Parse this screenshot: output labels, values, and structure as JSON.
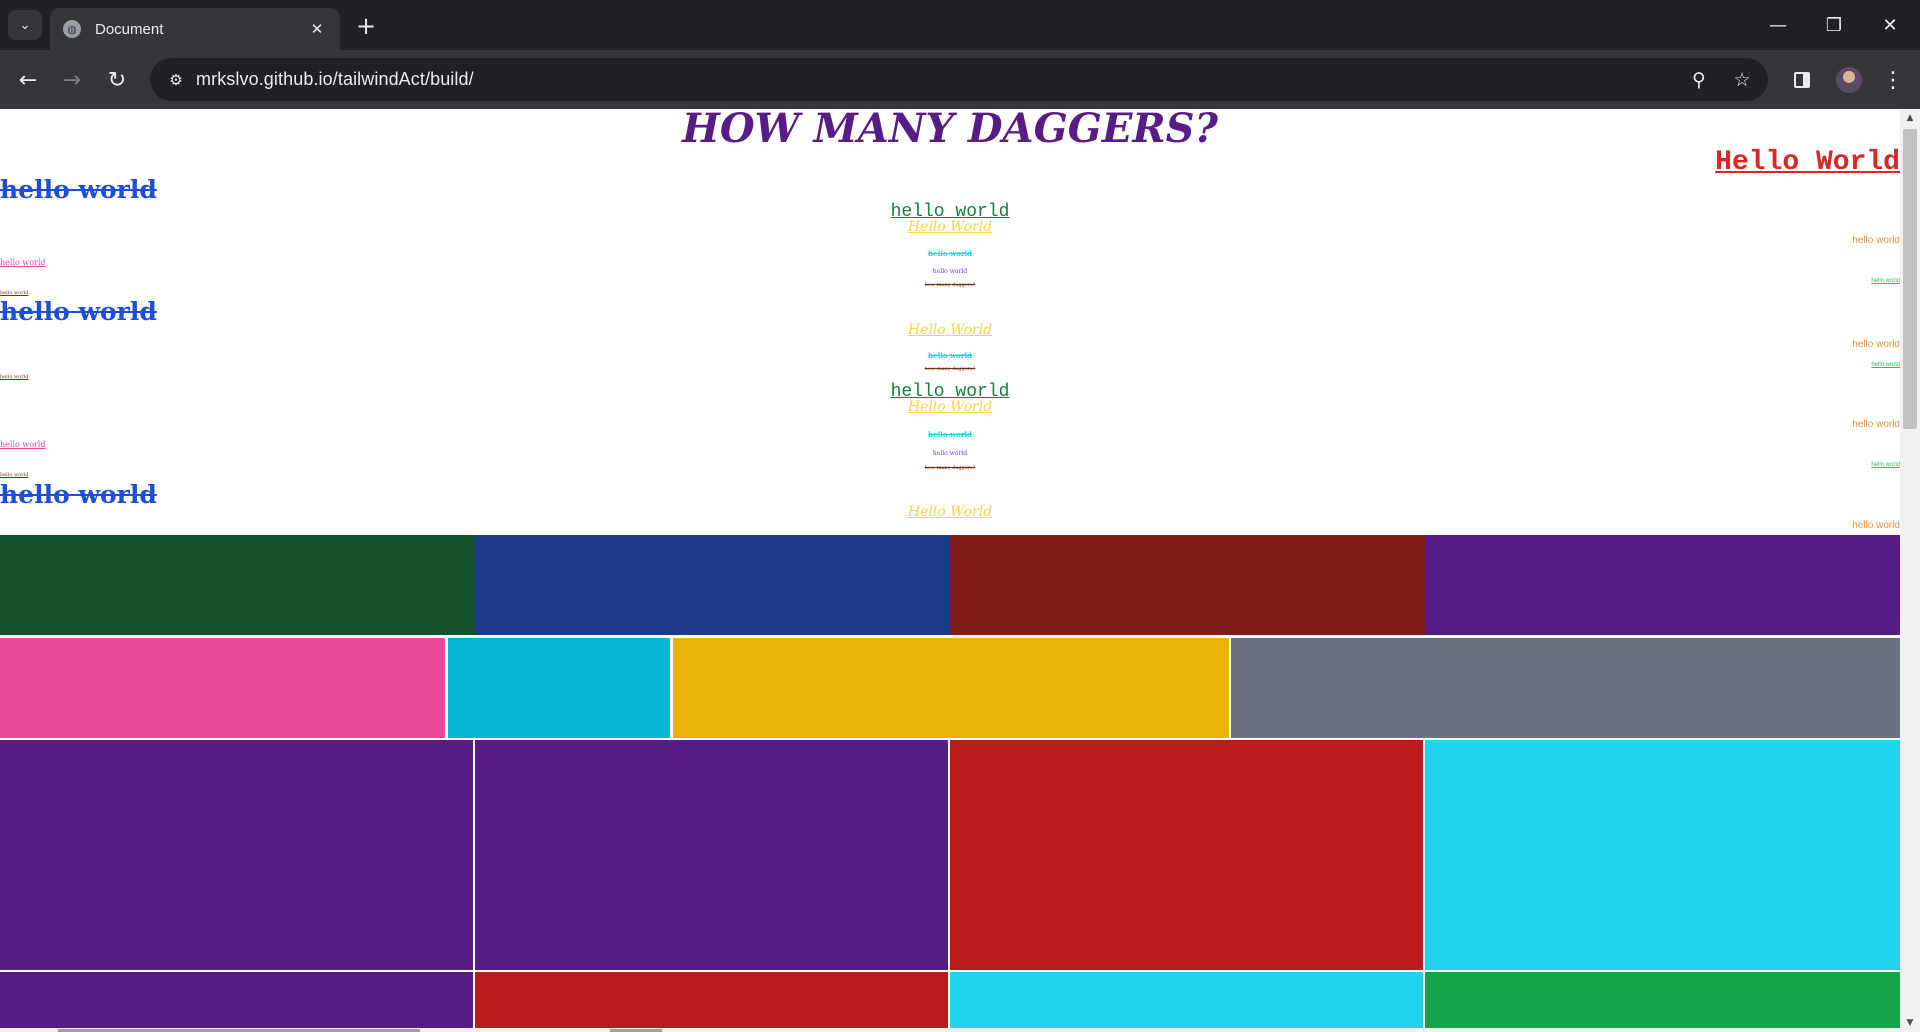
{
  "browser": {
    "tab_title": "Document",
    "url": "mrkslvo.github.io/tailwindAct/build/",
    "icons": {
      "tab_search": "chevron-down-icon",
      "favicon": "globe-icon",
      "tab_close": "close-icon",
      "new_tab": "plus-icon",
      "minimize": "minimize-icon",
      "restore": "restore-icon",
      "close": "close-icon",
      "back": "arrow-left-icon",
      "forward": "arrow-right-icon",
      "reload": "reload-icon",
      "site_info": "tune-icon",
      "zoom": "zoom-icon",
      "bookmark": "star-icon",
      "side_panel": "side-panel-icon",
      "profile": "avatar",
      "menu": "more-vert-icon"
    }
  },
  "page": {
    "heading": "HOW MANY DAGGERS?",
    "texts": {
      "hello_world_lower": "hello world",
      "hello_world_mono": "hello_world",
      "hello_world_title": "Hello World",
      "how_many_daggers": "how many daggers?"
    },
    "colors": {
      "heading": "#581c87",
      "red": "#dc2626",
      "blue": "#1d4ed8",
      "green": "#15803d",
      "yellow": "#fcd34d",
      "cyan": "#22d3ee",
      "purple": "#7c3aed",
      "brown": "#7c2d12",
      "pink": "#ec4899",
      "orange": "#fb923c",
      "teal_green": "#22c55e"
    },
    "grid_rows": [
      [
        "#14532d",
        "#1e3a8a",
        "#7f1d1d",
        "#581c87"
      ],
      [
        "#ec4899",
        "#06b6d4",
        "#eab308",
        "#6b7280"
      ],
      [
        "#581c87",
        "#581c87",
        "#b91c1c",
        "#22d3ee"
      ],
      [
        "#581c87",
        "#b91c1c",
        "#22d3ee",
        "#16a34a"
      ]
    ]
  }
}
